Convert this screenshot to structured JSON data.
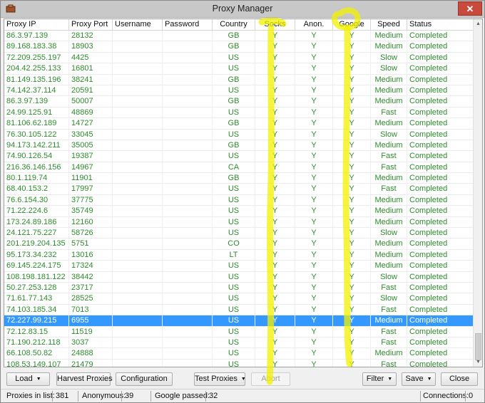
{
  "window": {
    "title": "Proxy Manager",
    "close_label": "✕"
  },
  "columns": [
    {
      "key": "ip",
      "label": "Proxy IP"
    },
    {
      "key": "port",
      "label": "Proxy Port"
    },
    {
      "key": "user",
      "label": "Username"
    },
    {
      "key": "pass",
      "label": "Password"
    },
    {
      "key": "country",
      "label": "Country"
    },
    {
      "key": "socks",
      "label": "Socks"
    },
    {
      "key": "anon",
      "label": "Anon."
    },
    {
      "key": "google",
      "label": "Google"
    },
    {
      "key": "speed",
      "label": "Speed"
    },
    {
      "key": "status",
      "label": "Status"
    }
  ],
  "rows": [
    [
      "86.3.97.139",
      "28132",
      "",
      "",
      "GB",
      "Y",
      "Y",
      "Y",
      "Medium",
      "Completed"
    ],
    [
      "89.168.183.38",
      "18903",
      "",
      "",
      "GB",
      "Y",
      "Y",
      "Y",
      "Medium",
      "Completed"
    ],
    [
      "72.209.255.197",
      "4425",
      "",
      "",
      "US",
      "Y",
      "Y",
      "Y",
      "Slow",
      "Completed"
    ],
    [
      "204.42.255.133",
      "16801",
      "",
      "",
      "US",
      "Y",
      "Y",
      "Y",
      "Slow",
      "Completed"
    ],
    [
      "81.149.135.196",
      "38241",
      "",
      "",
      "GB",
      "Y",
      "Y",
      "Y",
      "Medium",
      "Completed"
    ],
    [
      "74.142.37.114",
      "20591",
      "",
      "",
      "US",
      "Y",
      "Y",
      "Y",
      "Medium",
      "Completed"
    ],
    [
      "86.3.97.139",
      "50007",
      "",
      "",
      "GB",
      "Y",
      "Y",
      "Y",
      "Medium",
      "Completed"
    ],
    [
      "24.99.125.91",
      "48869",
      "",
      "",
      "US",
      "Y",
      "Y",
      "Y",
      "Fast",
      "Completed"
    ],
    [
      "81.106.62.189",
      "14727",
      "",
      "",
      "GB",
      "Y",
      "Y",
      "Y",
      "Medium",
      "Completed"
    ],
    [
      "76.30.105.122",
      "33045",
      "",
      "",
      "US",
      "Y",
      "Y",
      "Y",
      "Slow",
      "Completed"
    ],
    [
      "94.173.142.211",
      "35005",
      "",
      "",
      "GB",
      "Y",
      "Y",
      "Y",
      "Medium",
      "Completed"
    ],
    [
      "74.90.126.54",
      "19387",
      "",
      "",
      "US",
      "Y",
      "Y",
      "Y",
      "Fast",
      "Completed"
    ],
    [
      "216.36.146.156",
      "14967",
      "",
      "",
      "CA",
      "Y",
      "Y",
      "Y",
      "Fast",
      "Completed"
    ],
    [
      "80.1.119.74",
      "11901",
      "",
      "",
      "GB",
      "Y",
      "Y",
      "Y",
      "Medium",
      "Completed"
    ],
    [
      "68.40.153.2",
      "17997",
      "",
      "",
      "US",
      "Y",
      "Y",
      "Y",
      "Fast",
      "Completed"
    ],
    [
      "76.6.154.30",
      "37775",
      "",
      "",
      "US",
      "Y",
      "Y",
      "Y",
      "Medium",
      "Completed"
    ],
    [
      "71.22.224.6",
      "35749",
      "",
      "",
      "US",
      "Y",
      "Y",
      "Y",
      "Medium",
      "Completed"
    ],
    [
      "173.24.89.186",
      "12160",
      "",
      "",
      "US",
      "Y",
      "Y",
      "Y",
      "Medium",
      "Completed"
    ],
    [
      "24.121.75.227",
      "58726",
      "",
      "",
      "US",
      "Y",
      "Y",
      "Y",
      "Slow",
      "Completed"
    ],
    [
      "201.219.204.135",
      "5751",
      "",
      "",
      "CO",
      "Y",
      "Y",
      "Y",
      "Medium",
      "Completed"
    ],
    [
      "95.173.34.232",
      "13016",
      "",
      "",
      "LT",
      "Y",
      "Y",
      "Y",
      "Medium",
      "Completed"
    ],
    [
      "69.145.224.175",
      "17324",
      "",
      "",
      "US",
      "Y",
      "Y",
      "Y",
      "Medium",
      "Completed"
    ],
    [
      "108.198.181.122",
      "38442",
      "",
      "",
      "US",
      "Y",
      "Y",
      "Y",
      "Slow",
      "Completed"
    ],
    [
      "50.27.253.128",
      "23717",
      "",
      "",
      "US",
      "Y",
      "Y",
      "Y",
      "Fast",
      "Completed"
    ],
    [
      "71.61.77.143",
      "28525",
      "",
      "",
      "US",
      "Y",
      "Y",
      "Y",
      "Slow",
      "Completed"
    ],
    [
      "74.103.185.34",
      "7013",
      "",
      "",
      "US",
      "Y",
      "Y",
      "Y",
      "Fast",
      "Completed"
    ],
    [
      "72.227.99.215",
      "6955",
      "",
      "",
      "US",
      "Y",
      "Y",
      "Y",
      "Medium",
      "Completed"
    ],
    [
      "72.12.83.15",
      "11519",
      "",
      "",
      "US",
      "Y",
      "Y",
      "Y",
      "Fast",
      "Completed"
    ],
    [
      "71.190.212.118",
      "3037",
      "",
      "",
      "US",
      "Y",
      "Y",
      "Y",
      "Fast",
      "Completed"
    ],
    [
      "66.108.50.82",
      "24888",
      "",
      "",
      "US",
      "Y",
      "Y",
      "Y",
      "Medium",
      "Completed"
    ],
    [
      "108.53.149.107",
      "21479",
      "",
      "",
      "US",
      "Y",
      "Y",
      "Y",
      "Fast",
      "Completed"
    ]
  ],
  "selected_row": 26,
  "toolbar": {
    "load": "Load",
    "harvest": "Harvest Proxies",
    "configuration": "Configuration",
    "test": "Test Proxies",
    "abort": "Abort",
    "filter": "Filter",
    "save": "Save",
    "close": "Close"
  },
  "status": {
    "proxies_label": "Proxies in list:",
    "proxies_value": "381",
    "anon_label": "Anonymous:",
    "anon_value": "39",
    "google_label": "Google passed:",
    "google_value": "32",
    "conn_label": "Connections:",
    "conn_value": "0"
  },
  "colors": {
    "text_green": "#2e8b2e",
    "selection": "#3399ff",
    "highlighter": "#f2f200",
    "close_red": "#c74a3d"
  }
}
